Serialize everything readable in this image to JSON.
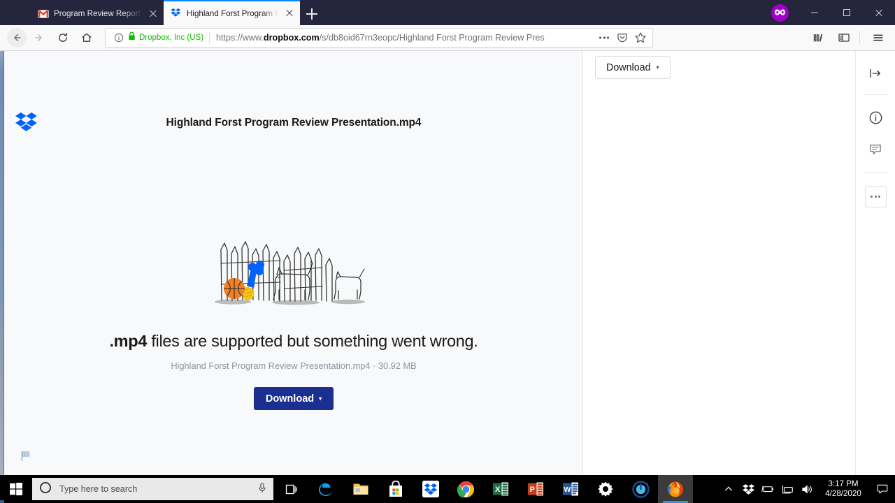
{
  "browser": {
    "tabs": [
      {
        "title": "Program Review Report and Pre",
        "favicon": "gmail-icon",
        "active": false
      },
      {
        "title": "Highland Forst Program Review",
        "favicon": "dropbox-icon",
        "active": true
      }
    ],
    "new_tab_label": "+",
    "container_badge": "mask-icon",
    "window_controls": {
      "minimize": "minimize-icon",
      "maximize": "maximize-icon",
      "close": "close-icon"
    },
    "nav": {
      "back": "back-arrow-icon",
      "forward": "forward-arrow-icon",
      "reload": "reload-icon",
      "home": "home-icon"
    },
    "urlbar": {
      "info_icon": "page-info-icon",
      "lock_icon": "padlock-icon",
      "identity": "Dropbox, Inc (US)",
      "url_prefix": "https://www.",
      "url_domain": "dropbox.com",
      "url_path": "/s/db8oid67rn3eopc/Highland Forst Program Review Pres",
      "page_actions_icon": "ellipsis-icon",
      "pocket_icon": "pocket-shield-icon",
      "bookmark_icon": "star-icon"
    },
    "toolbar_right": {
      "library": "library-books-icon",
      "sidebar": "sidebar-toggle-icon",
      "menu": "hamburger-menu-icon"
    }
  },
  "dropbox": {
    "logo": "dropbox-logo",
    "file_title": "Highland Forst Program Review Presentation.mp4",
    "download_secondary_label": "Download",
    "download_secondary_caret": "▾",
    "empty_state": {
      "illustration": "fence-dogs-illustration",
      "headline_bold": ".mp4",
      "headline_rest": " files are supported but something went wrong.",
      "file_meta": "Highland Forst Program Review Presentation.mp4 · 30.92 MB",
      "download_label": "Download",
      "download_caret": "▾"
    },
    "flag_button": "report-flag-icon",
    "rail": {
      "collapse": "collapse-panel-icon",
      "info": "info-circle-icon",
      "comment": "comment-bubble-icon",
      "more": "more-options-icon"
    }
  },
  "taskbar": {
    "start": "windows-start-icon",
    "search_placeholder": "Type here to search",
    "search_circle_icon": "cortana-circle-icon",
    "mic_icon": "microphone-icon",
    "task_view": "task-view-icon",
    "apps": [
      {
        "name": "edge-icon",
        "running": false,
        "active": false
      },
      {
        "name": "file-explorer-icon",
        "running": false,
        "active": false
      },
      {
        "name": "microsoft-store-icon",
        "running": false,
        "active": false
      },
      {
        "name": "dropbox-icon",
        "running": false,
        "active": false
      },
      {
        "name": "chrome-icon",
        "running": true,
        "active": false
      },
      {
        "name": "excel-icon",
        "running": true,
        "active": false
      },
      {
        "name": "powerpoint-icon",
        "running": true,
        "active": false
      },
      {
        "name": "word-icon",
        "running": true,
        "active": false
      },
      {
        "name": "settings-gear-icon",
        "running": true,
        "active": false
      },
      {
        "name": "blue-circle-app-icon",
        "running": true,
        "active": false
      },
      {
        "name": "firefox-icon",
        "running": true,
        "active": true
      }
    ],
    "tray": {
      "chevron": "show-hidden-icons-icon",
      "dropbox": "dropbox-tray-icon",
      "battery": "battery-icon",
      "network": "network-icon",
      "volume": "volume-icon",
      "time": "3:17 PM",
      "date": "4/28/2020",
      "action_center": "action-center-icon"
    }
  },
  "colors": {
    "dropbox_blue": "#0061fe",
    "download_navy": "#1a2f8f",
    "secure_green": "#12bc00",
    "firefox_tabstrip": "#26253e",
    "taskbar_accent": "#3a8fd4"
  }
}
